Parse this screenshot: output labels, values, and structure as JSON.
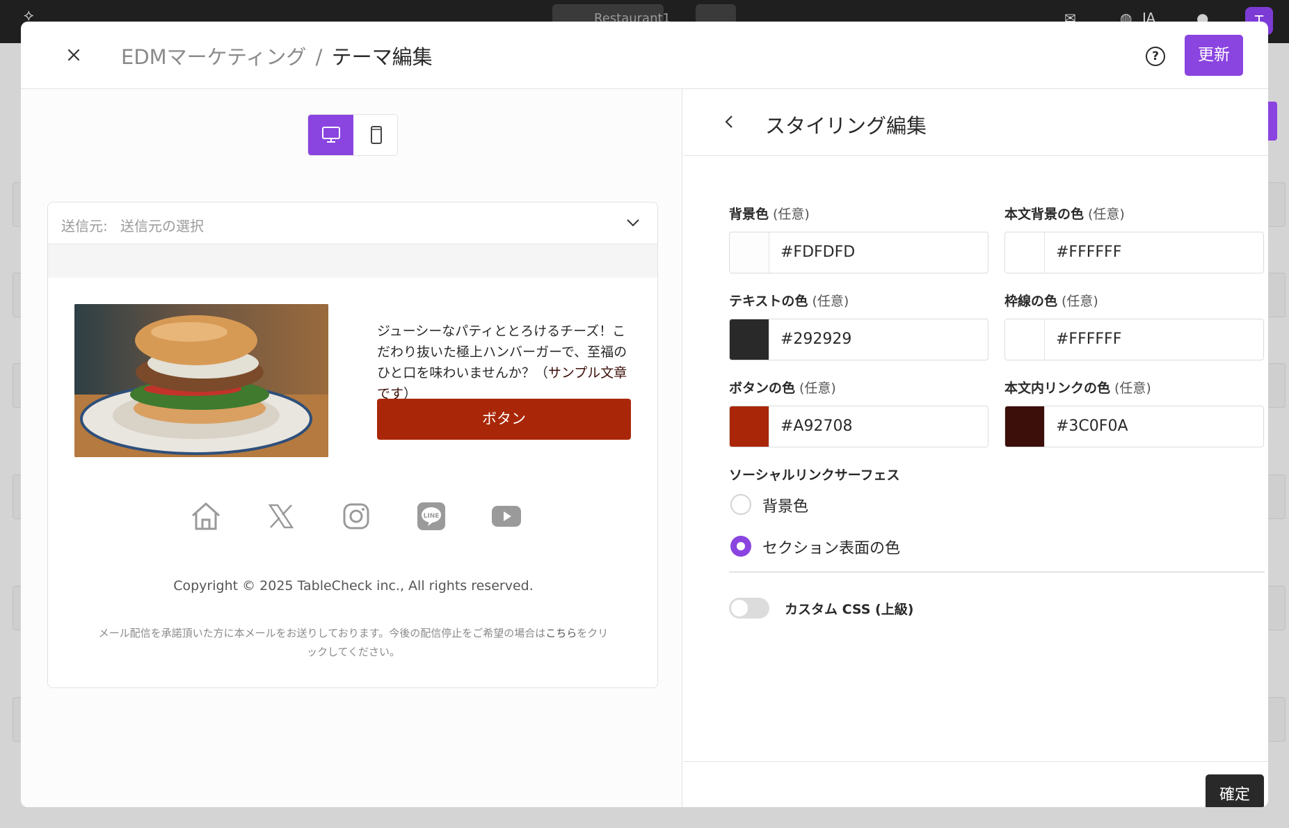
{
  "background_app": {
    "search_tab_text": "Restaurant1",
    "language": "JA",
    "avatar_initial": "T"
  },
  "modal": {
    "breadcrumb": {
      "parent": "EDMマーケティング",
      "separator": "/",
      "current": "テーマ編集"
    },
    "update_label": "更新"
  },
  "preview": {
    "device_modes": [
      "desktop",
      "mobile"
    ],
    "active_device": "desktop",
    "sender": {
      "label": "送信元:",
      "placeholder": "送信元の選択"
    },
    "body_text": "ジューシーなパティととろけるチーズ！こだわり抜いた極上ハンバーガーで、至福のひと口を味わいませんか？（",
    "body_link": "サンプル文章です",
    "body_text_end": "）",
    "button_label": "ボタン",
    "social_icons": [
      "home-icon",
      "x-icon",
      "instagram-icon",
      "line-icon",
      "youtube-icon"
    ],
    "copyright": "Copyright © 2025 TableCheck inc., All rights reserved.",
    "footer_note_pre": "メール配信を承諾頂いた方に本メールをお送りしております。今後の配信停止をご希望の場合は",
    "footer_note_link": "こちら",
    "footer_note_post": "をクリックしてください。"
  },
  "styling": {
    "title": "スタイリング編集",
    "optional_label": "(任意)",
    "fields": [
      {
        "label": "背景色",
        "value": "#FDFDFD",
        "color": "#FDFDFD"
      },
      {
        "label": "本文背景の色",
        "value": "#FFFFFF",
        "color": "#FFFFFF"
      },
      {
        "label": "テキストの色",
        "value": "#292929",
        "color": "#292929"
      },
      {
        "label": "枠線の色",
        "value": "#FFFFFF",
        "color": "#FFFFFF"
      },
      {
        "label": "ボタンの色",
        "value": "#A92708",
        "color": "#A92708"
      },
      {
        "label": "本文内リンクの色",
        "value": "#3C0F0A",
        "color": "#3C0F0A"
      }
    ],
    "social_surface": {
      "label": "ソーシャルリンクサーフェス",
      "options": [
        {
          "label": "背景色",
          "checked": false
        },
        {
          "label": "セクション表面の色",
          "checked": true
        }
      ]
    },
    "custom_css": {
      "label": "カスタム CSS (上級)",
      "enabled": false
    },
    "confirm_label": "確定"
  },
  "colors": {
    "accent": "#8A44E0",
    "dark": "#292929"
  }
}
